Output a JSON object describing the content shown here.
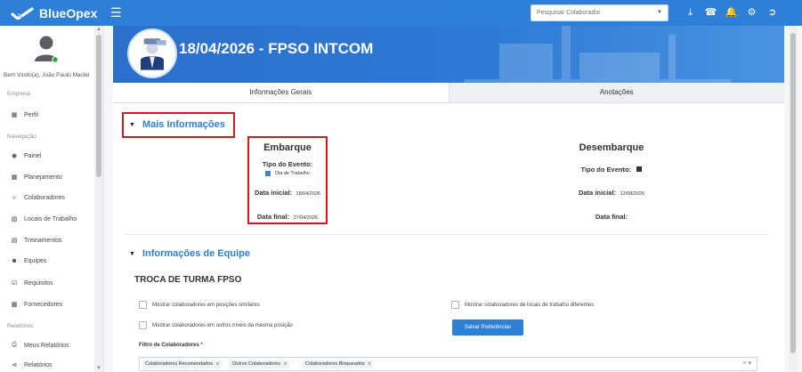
{
  "app": {
    "name": "BlueOpex"
  },
  "topbar": {
    "search_placeholder": "Pesquisar Colaborador",
    "icons": [
      "download-icon",
      "support-icon",
      "bell-icon",
      "gear-icon",
      "logout-icon"
    ]
  },
  "sidebar": {
    "welcome": "Bem Vindo(a), João Paulo Maciel",
    "sections": {
      "empresa": "Empresa",
      "navegacao": "Navegação",
      "relatorios": "Relatórios"
    },
    "items": [
      {
        "label": "Perfil",
        "icon": "building-icon"
      },
      {
        "label": "Painel",
        "icon": "dashboard-icon"
      },
      {
        "label": "Planejamento",
        "icon": "calendar-icon"
      },
      {
        "label": "Colaboradores",
        "icon": "users-icon"
      },
      {
        "label": "Locais de Trabalho",
        "icon": "building-icon"
      },
      {
        "label": "Treinamentos",
        "icon": "training-icon"
      },
      {
        "label": "Equipes",
        "icon": "team-icon"
      },
      {
        "label": "Requisitos",
        "icon": "checklist-icon"
      },
      {
        "label": "Fornecedores",
        "icon": "supplier-icon"
      },
      {
        "label": "Meus Relatórios",
        "icon": "print-icon"
      },
      {
        "label": "Relatórios",
        "icon": "share-icon"
      }
    ]
  },
  "banner": {
    "title": "18/04/2026 - FPSO INTCOM"
  },
  "tabs": [
    {
      "label": "Informações Gerais",
      "active": true
    },
    {
      "label": "Anotações",
      "active": false
    }
  ],
  "mais_info": {
    "heading": "Mais Informações",
    "embarque": {
      "title": "Embarque",
      "tipo_label": "Tipo do Evento:",
      "tipo_value": "Dia de Trabalho",
      "tipo_color": "#4a7fc1",
      "inicial_label": "Data inicial:",
      "inicial_value": "18/04/2026",
      "final_label": "Data final:",
      "final_value": "27/04/2026"
    },
    "desembarque": {
      "title": "Desembarque",
      "tipo_label": "Tipo do Evento:",
      "tipo_color": "#333333",
      "inicial_label": "Data inicial:",
      "inicial_value": "12/08/2026",
      "final_label": "Data final:"
    }
  },
  "equipe": {
    "heading": "Informações de Equipe",
    "subtitle": "TROCA DE TURMA FPSO",
    "checkboxes": {
      "similares": "Mostrar colaboradores em posições similares",
      "outros_niveis": "Mostrar colaboradores em outros níveis da mesma posição",
      "locais_diferentes": "Mostrar colaboradores de locais de trabalho diferentes"
    },
    "save_button": "Salvar Preferências",
    "filter_label": "Filtro de Colaboradores",
    "filter_required": "*",
    "tags": [
      "Colaboradores Recomendados",
      "Outros Colaboradores",
      "Colaboradores Bloqueados"
    ],
    "tag_remove": "x"
  },
  "colors": {
    "primary": "#2e7fd6",
    "highlight": "#d7191c"
  }
}
